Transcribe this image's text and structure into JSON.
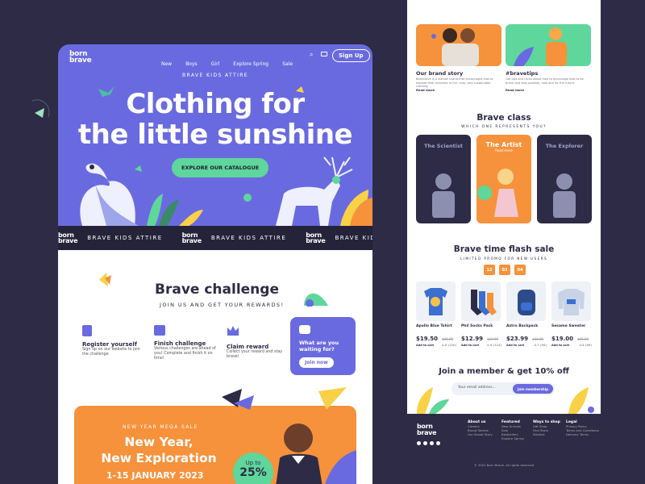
{
  "brand": {
    "line1": "born",
    "line2": "brave"
  },
  "nav": {
    "items": [
      "New",
      "Boys",
      "Girl",
      "Explore Spring",
      "Sale"
    ],
    "signup": "Sign Up"
  },
  "hero": {
    "kicker": "BRAVE KIDS ATTIRE",
    "title_line1": "Clothing for",
    "title_line2": "the little sunshine",
    "cta": "EXPLORE OUR CATALOGUE"
  },
  "marquee": {
    "text": "BRAVE KIDS ATTIRE"
  },
  "challenge": {
    "title": "Brave challenge",
    "subtitle": "JOIN US AND GET YOUR REWARDS!",
    "steps": [
      {
        "title": "Register yourself",
        "desc": "Sign up on our website to join the challenge"
      },
      {
        "title": "Finish challenge",
        "desc": "Various challenges are ahead of you! Complete and finish it on time!"
      },
      {
        "title": "Claim reward",
        "desc": "Collect your reward and stay brave!"
      }
    ],
    "card_title": "What are you waiting for?",
    "card_button": "Join now"
  },
  "promo": {
    "kicker": "NEW YEAR MEGA SALE",
    "title_line1": "New Year,",
    "title_line2": "New Exploration",
    "dates": "1-15 JANUARY 2023",
    "badge_top": "Up to",
    "badge_value": "25%"
  },
  "story": {
    "left_title": "Our brand story",
    "left_desc": "Bornbrave is a fashion brand that encourages kids to explore their interests in fun, cozy, and sustainable clothing.",
    "left_link": "Read more",
    "right_title": "#bravetips",
    "right_desc": "Get tips and tricks about how to encourage kids to be brave and stay positive, now and for the future.",
    "right_link": "Read more"
  },
  "brave_class": {
    "title": "Brave class",
    "subtitle": "WHICH ONE REPRESENTS YOU?",
    "cards": [
      {
        "label": "The Scientist"
      },
      {
        "label": "The Artist",
        "sub": "Read more"
      },
      {
        "label": "The Explorer"
      }
    ]
  },
  "flash_sale": {
    "title": "Brave time flash sale",
    "subtitle": "LIMITED PROMO FOR NEW USERS",
    "countdown": [
      "12",
      "03",
      "04"
    ],
    "products": [
      {
        "name": "Apollo Blue Tshirt",
        "price": "$19.50",
        "old": "$25.00",
        "cart": "Add to cart",
        "rating": "4.8 (120)"
      },
      {
        "name": "Phil Socks Pack",
        "price": "$12.99",
        "old": "$19.99",
        "cart": "Add to cart",
        "rating": "4.9 (114)"
      },
      {
        "name": "Astro Backpack",
        "price": "$23.99",
        "old": "$30.00",
        "cart": "Add to cart",
        "rating": "4.7 (98)"
      },
      {
        "name": "Sesame Sweater",
        "price": "$19.00",
        "old": "$25.00",
        "cart": "Add to cart",
        "rating": "4.8 (86)"
      }
    ]
  },
  "member": {
    "title": "Join a member & get 10% off",
    "placeholder": "Your email address...",
    "button": "Join membership"
  },
  "footer": {
    "cols": [
      {
        "h": "About us",
        "links": [
          "Careers",
          "Brand Stories",
          "Our Brand Story"
        ]
      },
      {
        "h": "Featured",
        "links": [
          "New Arrivals",
          "Sale",
          "Bestsellers",
          "Explore Spring"
        ]
      },
      {
        "h": "Ways to shop",
        "links": [
          "Gift Shop",
          "Find Store",
          "Wishlist"
        ]
      },
      {
        "h": "Legal",
        "links": [
          "Privacy Policy",
          "Terms and Conditions",
          "Delivery Terms"
        ]
      }
    ],
    "copyright": "© 2022 Born Brave. All rights reserved"
  },
  "colors": {
    "purple": "#6a6ae0",
    "orange": "#f6923b",
    "green": "#5fd69b",
    "dark": "#2d2b45"
  }
}
